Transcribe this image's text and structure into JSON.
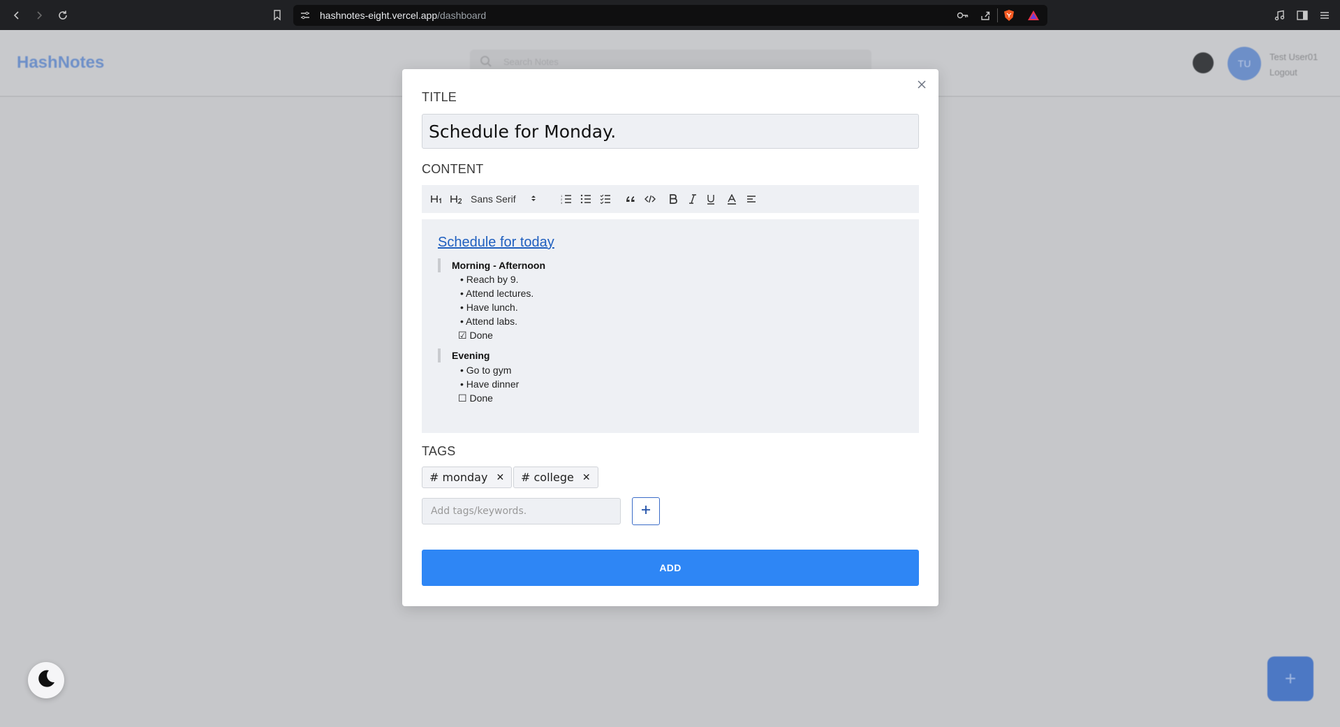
{
  "browser": {
    "url_host": "hashnotes-eight.vercel.app",
    "url_path": "/dashboard"
  },
  "app": {
    "brand": "HashNotes",
    "search_placeholder": "Search Notes",
    "avatar_initials": "TU",
    "user_name": "Test User01",
    "logout_label": "Logout",
    "fab_label": "+"
  },
  "modal": {
    "title_label": "TITLE",
    "title_value": "Schedule for Monday.",
    "content_label": "CONTENT",
    "toolbar": {
      "h1": "H1",
      "h2": "H2",
      "font": "Sans Serif"
    },
    "editor": {
      "heading": "Schedule for today",
      "sections": [
        {
          "title": "Morning - Afternoon",
          "items": [
            "Reach by 9.",
            "Attend lectures.",
            "Have lunch.",
            "Attend labs."
          ],
          "check_label": "Done",
          "checked": true
        },
        {
          "title": "Evening",
          "items": [
            "Go to gym",
            "Have dinner"
          ],
          "check_label": "Done",
          "checked": false
        }
      ]
    },
    "tags_label": "TAGS",
    "tags": [
      "# monday",
      "# college"
    ],
    "tag_input_placeholder": "Add tags/keywords.",
    "submit_label": "ADD"
  },
  "colors": {
    "accent": "#2e86f5",
    "link": "#1f5fbf"
  }
}
